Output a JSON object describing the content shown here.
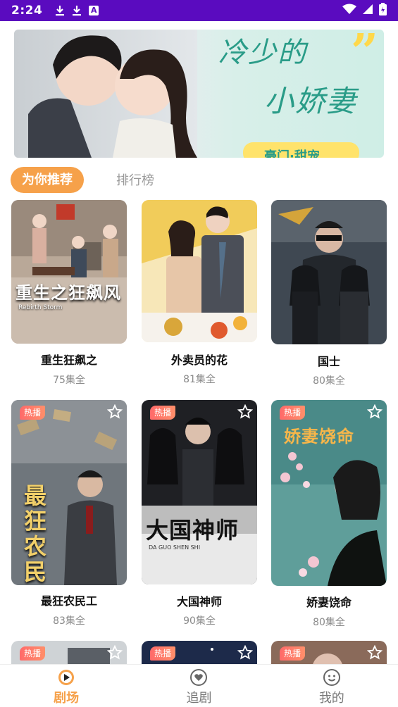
{
  "status_bar": {
    "time": "2:24",
    "notification_icon_a": "A"
  },
  "banner": {
    "title_line1": "冷少的",
    "title_line2": "小娇妻",
    "tag": "豪门·甜宠",
    "quote_mark": "”"
  },
  "tabs": [
    {
      "label": "为你推荐",
      "active": true
    },
    {
      "label": "排行榜",
      "active": false
    }
  ],
  "cards": [
    {
      "title": "重生狂飙之",
      "episodes": "75集全",
      "poster_text": "重生之狂飙风",
      "poster_subtext": "Rebirth Storm",
      "badge": "",
      "accent": "#8a5a3c"
    },
    {
      "title": "外卖员的花",
      "episodes": "81集全",
      "poster_text": "",
      "poster_subtext": "",
      "badge": "",
      "accent": "#f0c040"
    },
    {
      "title": "国士",
      "episodes": "80集全",
      "poster_text": "",
      "poster_subtext": "",
      "badge": "",
      "accent": "#3a4450"
    },
    {
      "title": "最狂农民工",
      "episodes": "83集全",
      "poster_text": "最狂农民工",
      "poster_subtext": "",
      "badge": "热播",
      "accent": "#555e66"
    },
    {
      "title": "大国神师",
      "episodes": "90集全",
      "poster_text": "大国神师",
      "poster_subtext": "DA GUO SHEN SHI",
      "badge": "热播",
      "accent": "#222"
    },
    {
      "title": "娇妻饶命",
      "episodes": "80集全",
      "poster_text": "娇妻饶命",
      "poster_subtext": "",
      "badge": "热播",
      "accent": "#4d8f8f"
    },
    {
      "title": "",
      "episodes": "",
      "poster_text": "",
      "poster_subtext": "",
      "badge": "热播",
      "accent": "#cfd3d6"
    },
    {
      "title": "",
      "episodes": "",
      "poster_text": "",
      "poster_subtext": "",
      "badge": "热播",
      "accent": "#1d2a4a"
    },
    {
      "title": "",
      "episodes": "",
      "poster_text": "",
      "poster_subtext": "",
      "badge": "热播",
      "accent": "#8a6a5a"
    }
  ],
  "bottom_nav": [
    {
      "label": "剧场",
      "icon": "theater-icon",
      "active": true
    },
    {
      "label": "追剧",
      "icon": "heart-icon",
      "active": false
    },
    {
      "label": "我的",
      "icon": "smile-icon",
      "active": false
    }
  ],
  "colors": {
    "status_bar": "#5a0bbf",
    "accent": "#f6a14a",
    "badge": "#ff6a6a"
  }
}
